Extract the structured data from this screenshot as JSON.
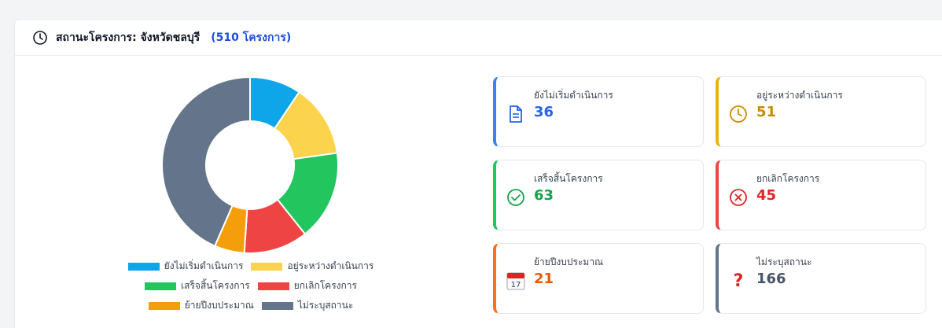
{
  "header": {
    "title": "สถานะโครงการ: จังหวัดชลบุรี",
    "count": "(510 โครงการ)"
  },
  "colors": {
    "not_started": "#0ea5e9",
    "in_progress": "#fcd34d",
    "completed": "#22c55e",
    "cancelled": "#ef4444",
    "moved_budget": "#f59e0b",
    "unspecified": "#64748b"
  },
  "chart_data": {
    "type": "pie",
    "donut": true,
    "categories": [
      "ยังไม่เริ่มดำเนินการ",
      "อยู่ระหว่างดำเนินการ",
      "เสร็จสิ้นโครงการ",
      "ยกเลิกโครงการ",
      "ย้ายปีงบประมาณ",
      "ไม่ระบุสถานะ"
    ],
    "values": [
      36,
      51,
      63,
      45,
      21,
      166
    ],
    "colors": [
      "#0ea5e9",
      "#fcd34d",
      "#22c55e",
      "#ef4444",
      "#f59e0b",
      "#64748b"
    ],
    "legend": "bottom"
  },
  "stats": [
    {
      "label": "ยังไม่เริ่มดำเนินการ",
      "value": "36",
      "color": "#2563eb",
      "icon": "document-icon"
    },
    {
      "label": "อยู่ระหว่างดำเนินการ",
      "value": "51",
      "color": "#ca8a04",
      "icon": "clock-icon"
    },
    {
      "label": "เสร็จสิ้นโครงการ",
      "value": "63",
      "color": "#16a34a",
      "icon": "check-circle-icon"
    },
    {
      "label": "ยกเลิกโครงการ",
      "value": "45",
      "color": "#dc2626",
      "icon": "x-circle-icon"
    },
    {
      "label": "ย้ายปีงบประมาณ",
      "value": "21",
      "color": "#ea580c",
      "icon": "calendar-icon",
      "icon_text": "17"
    },
    {
      "label": "ไม่ระบุสถานะ",
      "value": "166",
      "color": "#475569",
      "icon": "question-icon",
      "icon_text": "?"
    }
  ]
}
